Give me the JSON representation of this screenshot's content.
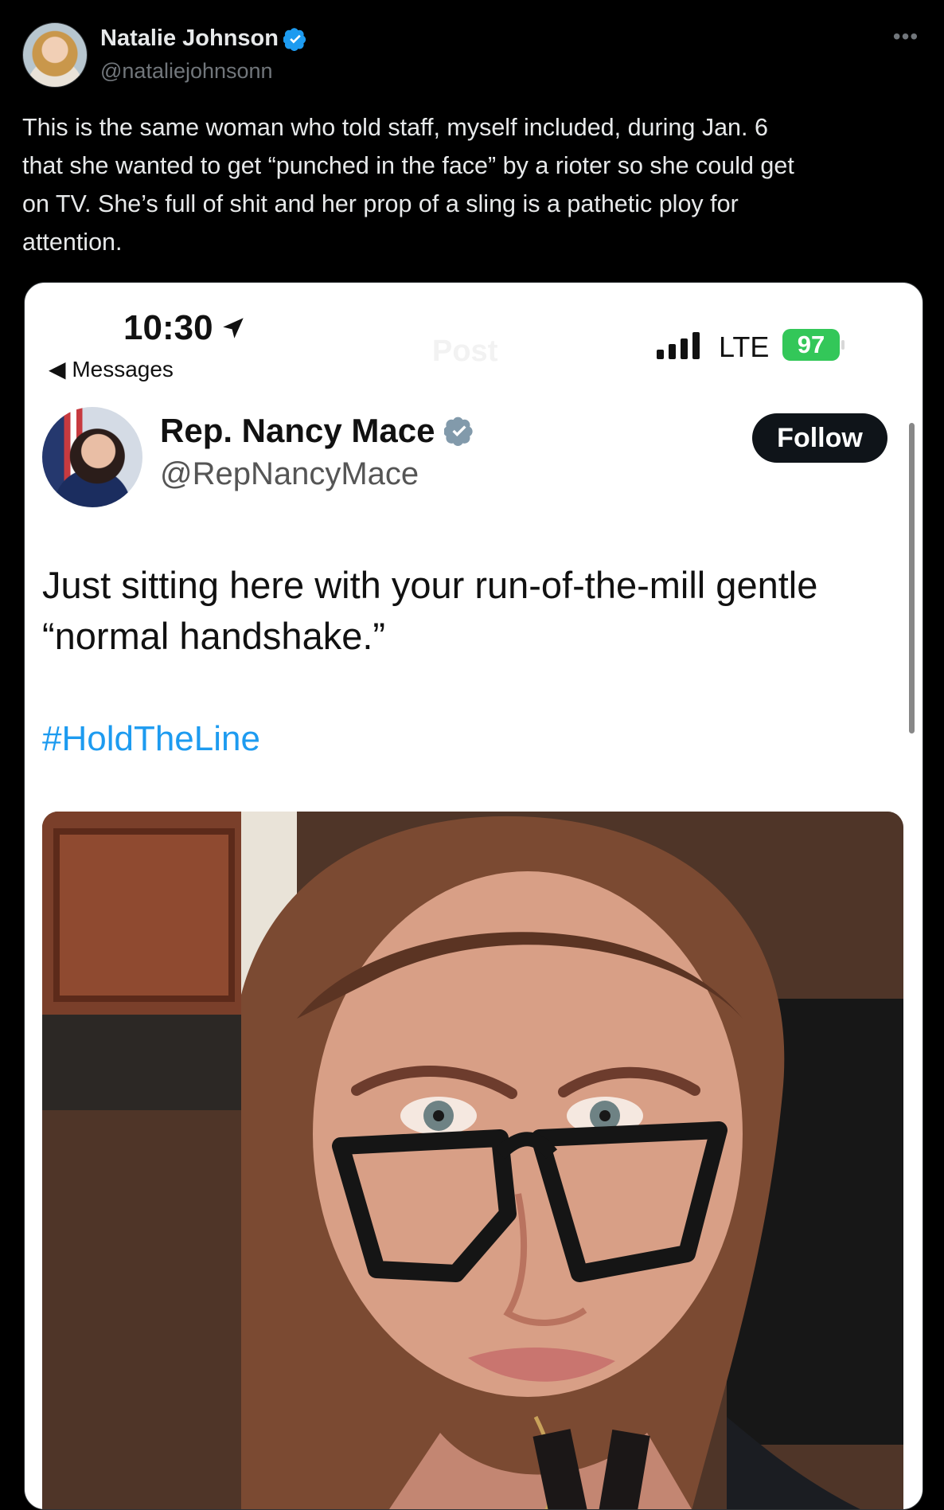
{
  "post": {
    "author_name": "Natalie Johnson",
    "author_handle": "@nataliejohnsonn",
    "verified_icon": "verified-badge-icon",
    "text": "This is the same woman who told staff, myself included, during Jan. 6\nthat she wanted to get “punched in the face” by a rioter so she could get\non TV. She’s full of shit and her prop of a sling is a pathetic ploy for\nattention."
  },
  "embedded_screenshot": {
    "status_time": "10:30",
    "back_label": "◀ Messages",
    "ghost_title": "Post",
    "network": "LTE",
    "battery": "97",
    "tweet_author": "Rep. Nancy Mace",
    "tweet_handle": "@RepNancyMace",
    "follow_label": "Follow",
    "tweet_text": "Just sitting here with your run-of-the-mill gentle\n“normal handshake.”",
    "hashtag": "#HoldTheLine"
  },
  "colors": {
    "background": "#000000",
    "text": "#e7e9ea",
    "muted": "#71767b",
    "verified": "#1d9bf0",
    "hashtag": "#1d9bf0",
    "battery": "#33c759"
  }
}
